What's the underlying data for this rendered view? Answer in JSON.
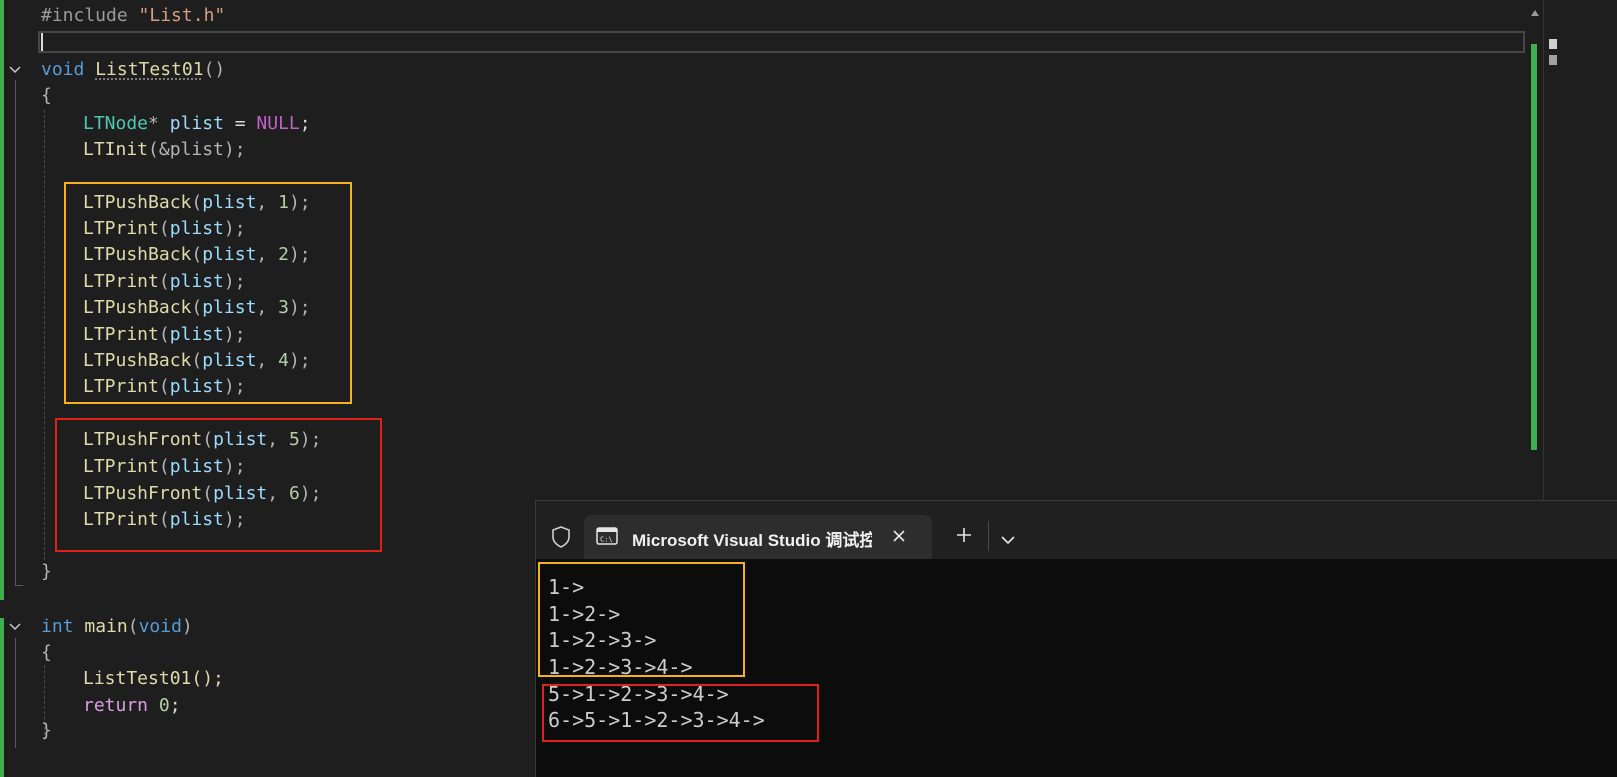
{
  "colors": {
    "yellow_box": "#f5b21a",
    "red_box": "#e0201b",
    "change_bar": "#3fae4c"
  },
  "editor": {
    "include": {
      "directive": "#include",
      "path": "\"List.h\""
    },
    "fn1": {
      "ret": "void",
      "name": "ListTest01",
      "parens": "()"
    },
    "brace_open": "{",
    "brace_close": "}",
    "decl": {
      "type": "LTNode",
      "star": "*",
      "var": "plist",
      "eq": " = ",
      "null": "NULL",
      "semi": ";"
    },
    "init": {
      "name": "LTInit",
      "args": "(&plist);"
    },
    "push_back": [
      {
        "fn": "LTPushBack",
        "var": "plist",
        "num": "1"
      },
      {
        "fn": "LTPushBack",
        "var": "plist",
        "num": "2"
      },
      {
        "fn": "LTPushBack",
        "var": "plist",
        "num": "3"
      },
      {
        "fn": "LTPushBack",
        "var": "plist",
        "num": "4"
      }
    ],
    "push_front": [
      {
        "fn": "LTPushFront",
        "var": "plist",
        "num": "5"
      },
      {
        "fn": "LTPushFront",
        "var": "plist",
        "num": "6"
      }
    ],
    "print": {
      "fn": "LTPrint",
      "var": "plist"
    },
    "main": {
      "ret": "int",
      "name": "main",
      "param": "void"
    },
    "call": "ListTest01();",
    "ret": {
      "kw": "return",
      "val": "0",
      "semi": ";"
    }
  },
  "terminal": {
    "tab_title": "Microsoft Visual Studio 调试控制台",
    "icons": [
      "shield-icon",
      "terminal-app-icon",
      "close-icon",
      "plus-icon",
      "chevron-down-icon"
    ],
    "output": [
      "1->",
      "1->2->",
      "1->2->3->",
      "1->2->3->4->",
      "5->1->2->3->4->",
      "6->5->1->2->3->4->"
    ]
  }
}
